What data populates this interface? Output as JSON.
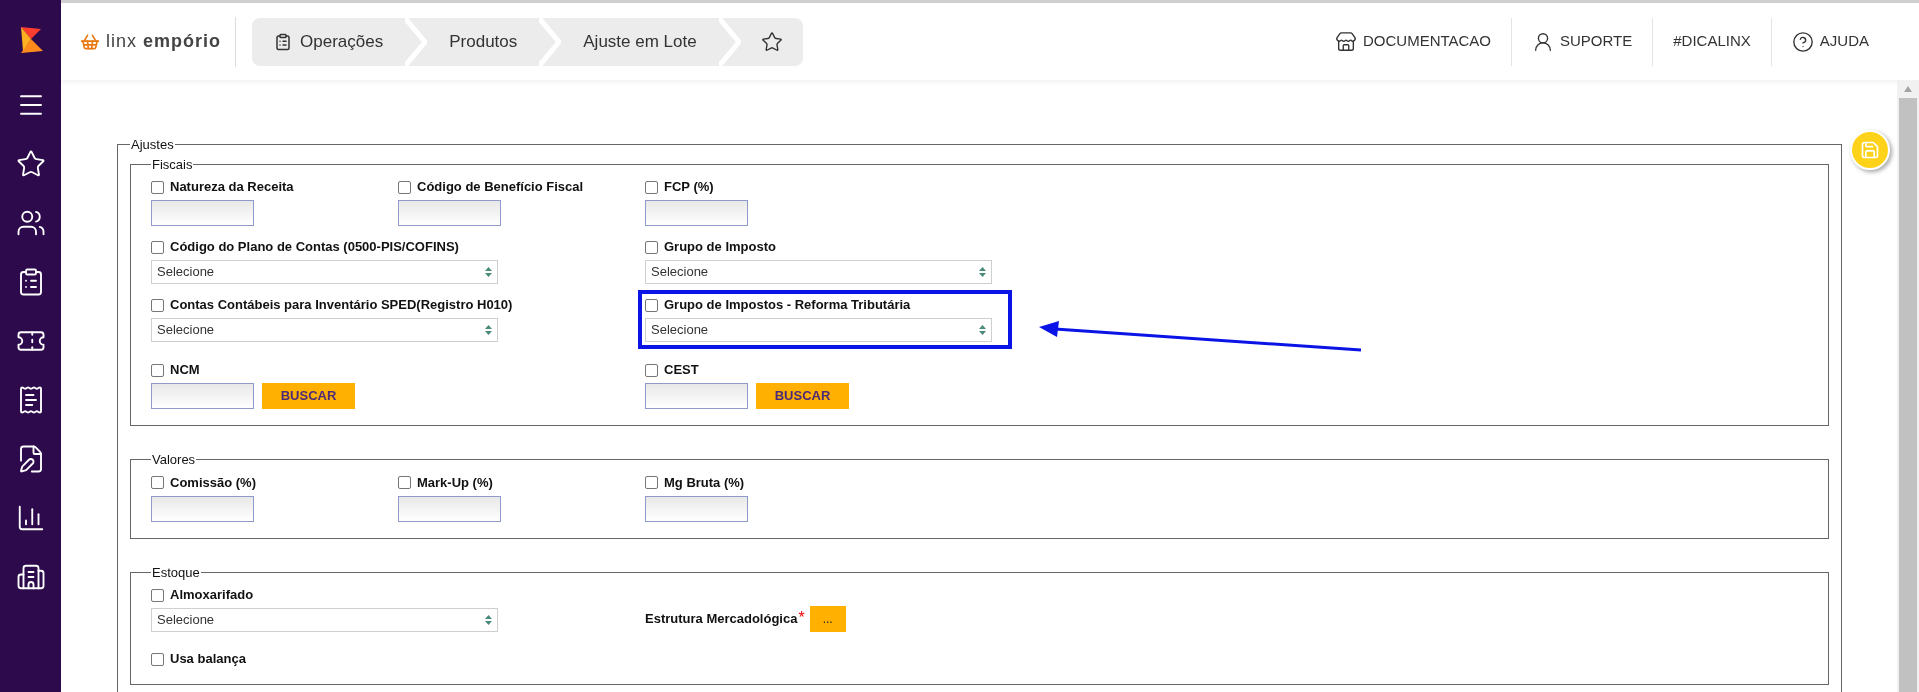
{
  "header": {
    "brand": {
      "prefix": "linx",
      "name": "empório"
    },
    "breadcrumbs": [
      {
        "label": "Operações",
        "kind": "icon_text"
      },
      {
        "label": "Produtos",
        "kind": "text"
      },
      {
        "label": "Ajuste em Lote",
        "kind": "text"
      }
    ],
    "links": [
      {
        "label": "DOCUMENTACAO",
        "kind": "docs"
      },
      {
        "label": "SUPORTE",
        "kind": "user"
      },
      {
        "label": "#DICALINX",
        "kind": "plain"
      },
      {
        "label": "AJUDA",
        "kind": "help"
      }
    ]
  },
  "form": {
    "title": "Ajustes",
    "sections": [
      {
        "title": "Fiscais",
        "fields": [
          {
            "kind": "text",
            "label": "Natureza da Receita",
            "checked": false,
            "highlighted": false
          },
          {
            "kind": "text",
            "label": "Código de Benefício Fiscal",
            "checked": false,
            "highlighted": false
          },
          {
            "kind": "text",
            "label": "FCP (%)",
            "checked": false,
            "highlighted": false
          },
          {
            "kind": "select",
            "label": "Código do Plano de Contas (0500-PIS/COFINS)",
            "checked": false,
            "value": "Selecione",
            "highlighted": false
          },
          {
            "kind": "select",
            "label": "Grupo de Imposto",
            "checked": false,
            "value": "Selecione",
            "highlighted": false
          },
          {
            "kind": "select",
            "label": "Contas Contábeis para Inventário SPED(Registro H010)",
            "checked": false,
            "value": "Selecione",
            "highlighted": false
          },
          {
            "kind": "select",
            "label": "Grupo de Impostos - Reforma Tributária",
            "checked": false,
            "value": "Selecione",
            "highlighted": true
          },
          {
            "kind": "search",
            "label": "NCM",
            "checked": false,
            "button": "BUSCAR",
            "highlighted": false
          },
          {
            "kind": "search",
            "label": "CEST",
            "checked": false,
            "button": "BUSCAR",
            "highlighted": false
          }
        ]
      },
      {
        "title": "Valores",
        "fields": [
          {
            "kind": "text",
            "label": "Comissão (%)",
            "checked": false,
            "highlighted": false
          },
          {
            "kind": "text",
            "label": "Mark-Up (%)",
            "checked": false,
            "highlighted": false
          },
          {
            "kind": "text",
            "label": "Mg Bruta (%)",
            "checked": false,
            "highlighted": false
          }
        ]
      },
      {
        "title": "Estoque",
        "fields": [
          {
            "kind": "select",
            "label": "Almoxarifado",
            "checked": false,
            "value": "Selecione",
            "highlighted": false
          },
          {
            "kind": "picker",
            "label": "Estrutura Mercadológica",
            "required_mark": "*",
            "button": "...",
            "highlighted": false
          },
          {
            "kind": "checkbox",
            "label": "Usa balança",
            "checked": false,
            "highlighted": false
          }
        ]
      }
    ]
  }
}
